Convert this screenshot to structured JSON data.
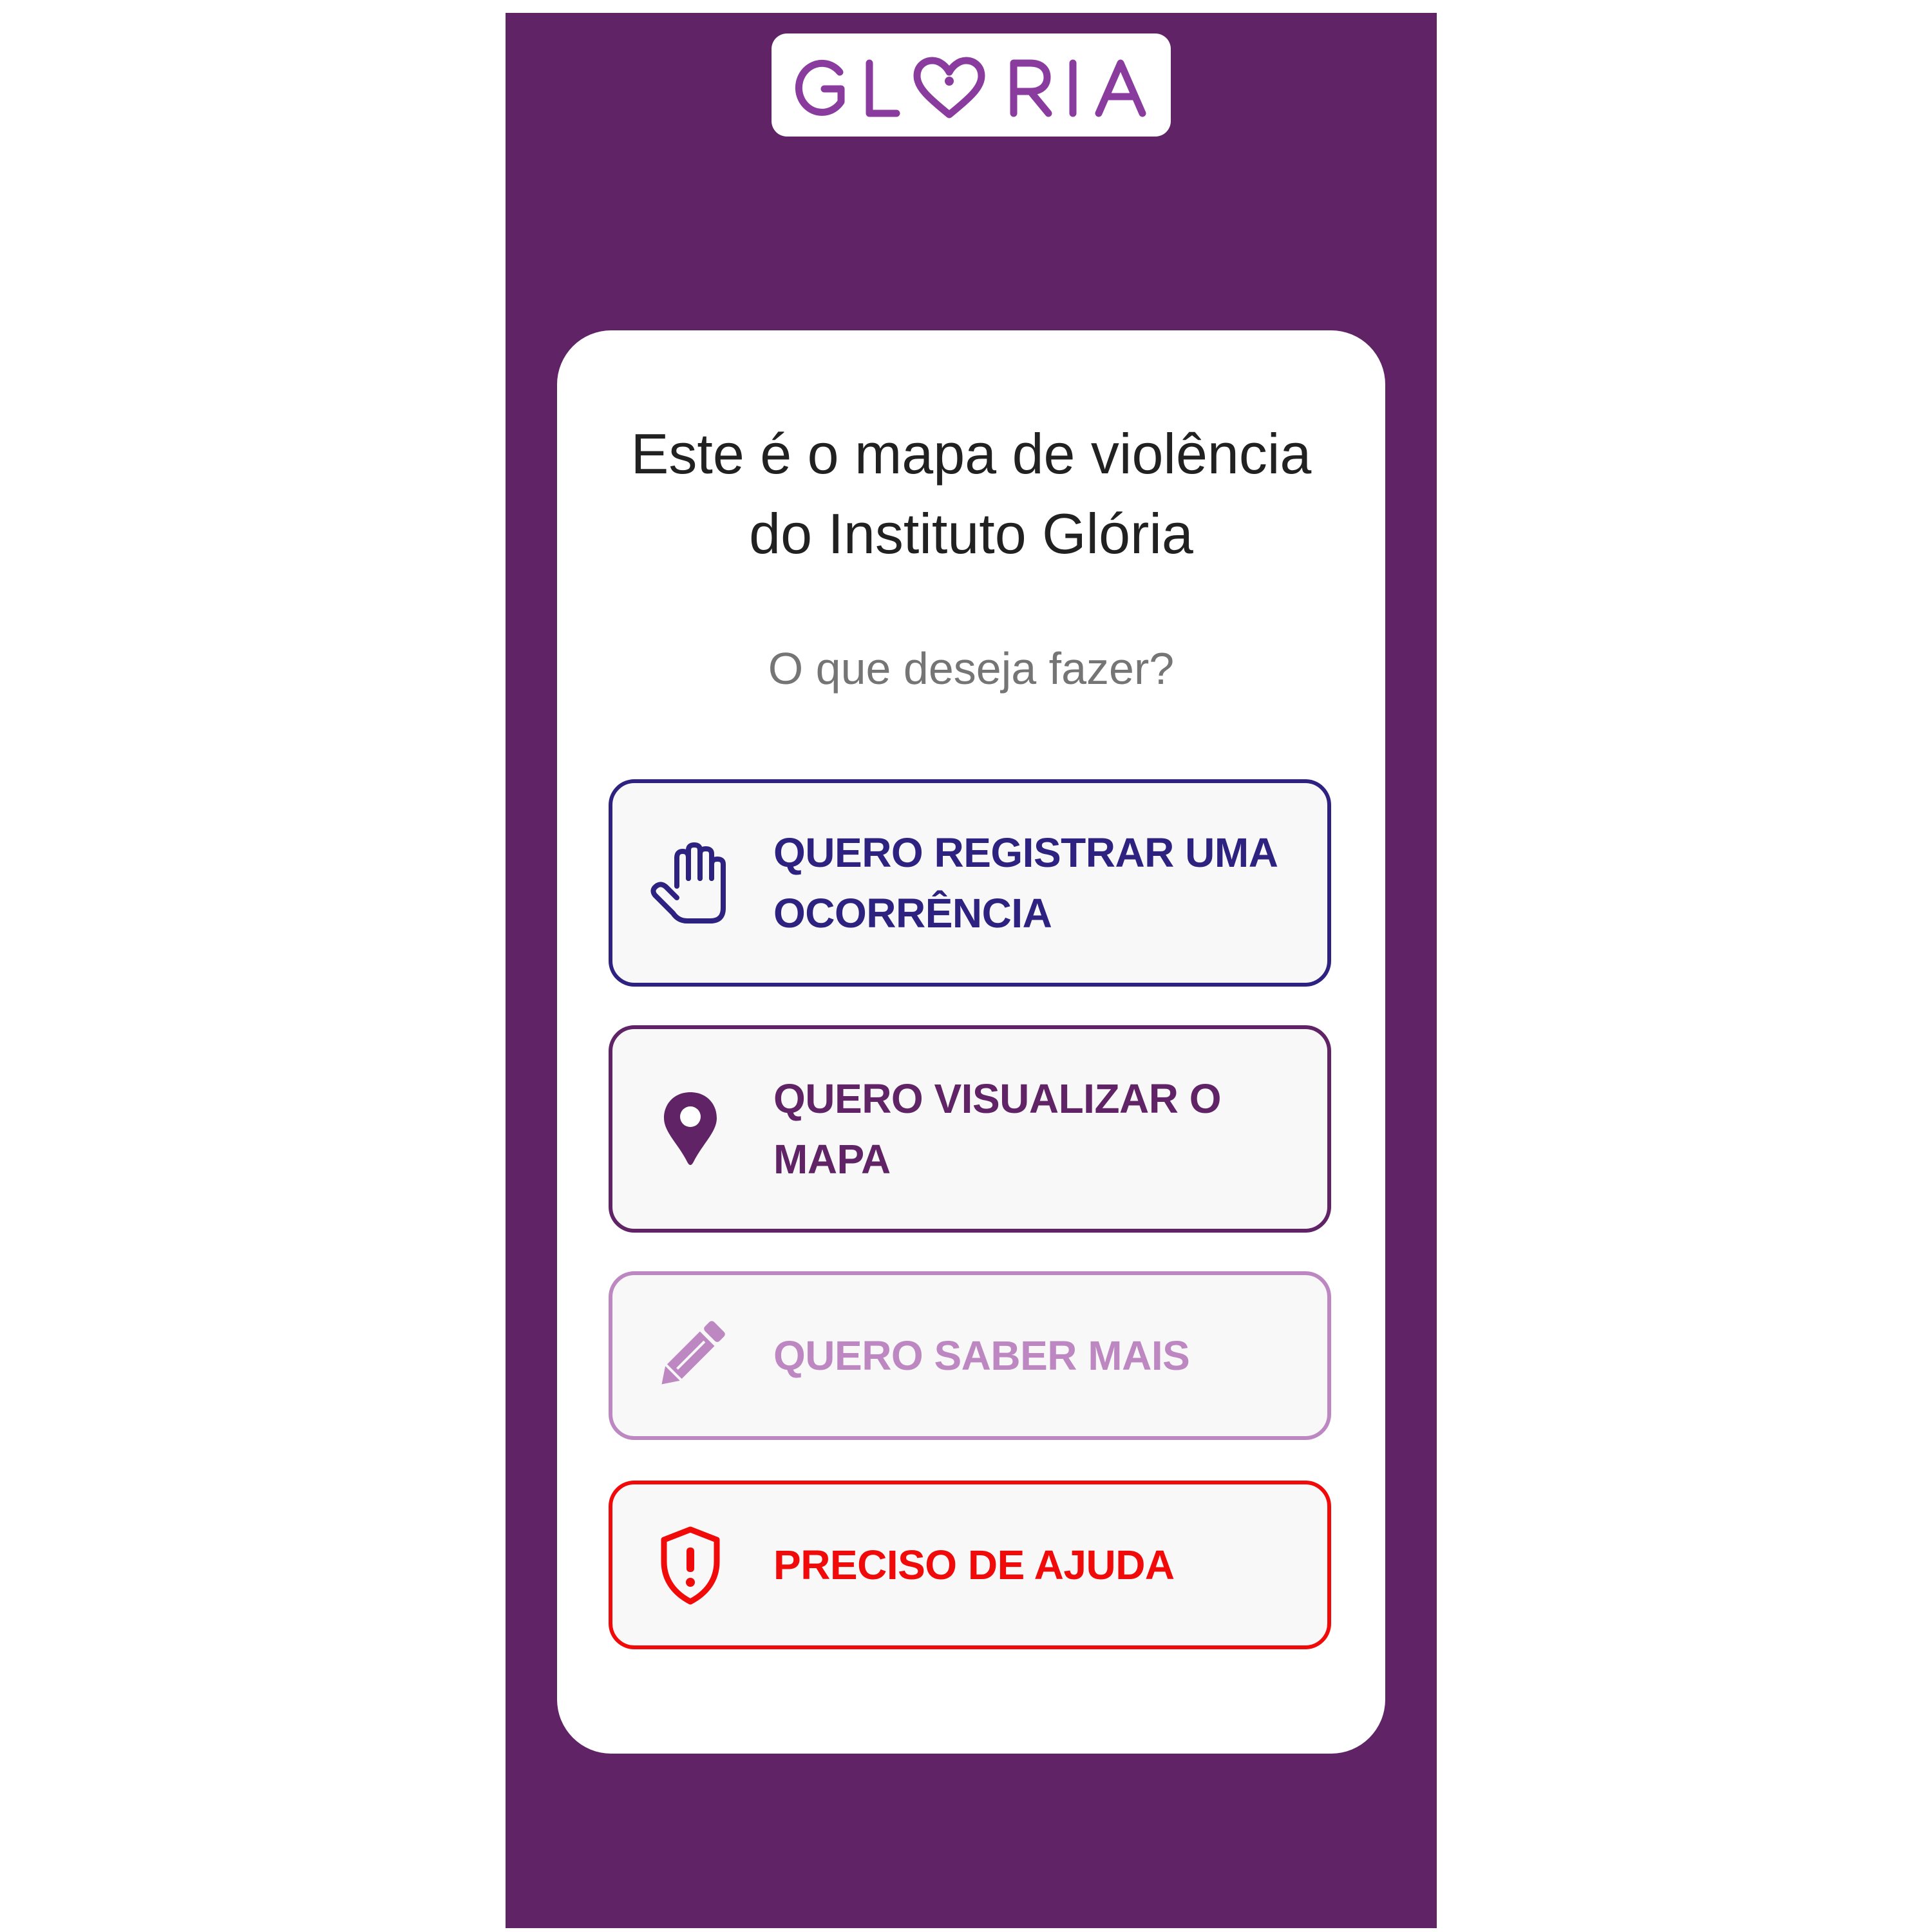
{
  "app": {
    "logo_text": "GLÓRIA",
    "logo_color": "#8a3b9e",
    "frame_color": "#5f2366"
  },
  "card": {
    "headline": "Este é o mapa de violência\ndo Instituto Glória",
    "subtitle": "O que deseja fazer?"
  },
  "actions": [
    {
      "label": "QUERO REGISTRAR UMA OCORRÊNCIA",
      "icon": "hand-stop-icon",
      "color": "#2e2280"
    },
    {
      "label": "QUERO VISUALIZAR O MAPA",
      "icon": "map-pin-icon",
      "color": "#5f2366"
    },
    {
      "label": "QUERO SABER MAIS",
      "icon": "pencil-icon",
      "color": "#bd88c2"
    },
    {
      "label": "PRECISO DE AJUDA",
      "icon": "shield-alert-icon",
      "color": "#f10a0a"
    }
  ]
}
